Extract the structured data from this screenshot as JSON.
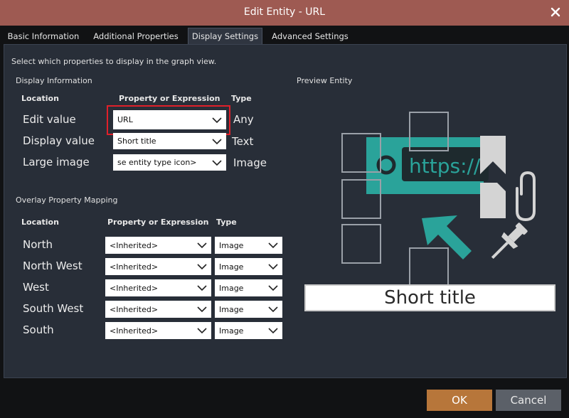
{
  "window": {
    "title": "Edit Entity - URL",
    "close_label": "✕"
  },
  "tabs": [
    {
      "label": "Basic Information"
    },
    {
      "label": "Additional Properties"
    },
    {
      "label": "Display Settings"
    },
    {
      "label": "Advanced Settings"
    }
  ],
  "active_tab": "Display Settings",
  "instructions": "Select which properties to display in the graph view.",
  "display_info": {
    "section_label": "Display Information",
    "headers": {
      "location": "Location",
      "property": "Property or Expression",
      "type": "Type"
    },
    "rows": [
      {
        "location": "Edit value",
        "property": "URL",
        "type": "Any"
      },
      {
        "location": "Display value",
        "property": "Short title",
        "type": "Text"
      },
      {
        "location": "Large image",
        "property": "se entity type icon>",
        "type": "Image"
      }
    ]
  },
  "overlay": {
    "section_label": "Overlay Property Mapping",
    "headers": {
      "location": "Location",
      "property": "Property or Expression",
      "type": "Type"
    },
    "rows": [
      {
        "location": "North",
        "property": "<Inherited>",
        "type": "Image"
      },
      {
        "location": "North West",
        "property": "<Inherited>",
        "type": "Image"
      },
      {
        "location": "West",
        "property": "<Inherited>",
        "type": "Image"
      },
      {
        "location": "South West",
        "property": "<Inherited>",
        "type": "Image"
      },
      {
        "location": "South",
        "property": "<Inherited>",
        "type": "Image"
      }
    ]
  },
  "preview": {
    "section_label": "Preview Entity",
    "url_text": "https://",
    "display_text": "Short title",
    "icon_names": [
      "url-icon",
      "bookmark-icon",
      "document-icon",
      "paperclip-icon",
      "cursor-arrow-icon",
      "pushpin-icon"
    ]
  },
  "buttons": {
    "ok": "OK",
    "cancel": "Cancel"
  },
  "colors": {
    "titlebar": "#9e5a52",
    "panel": "#282e38",
    "teal": "#2aa39a",
    "ok": "#b7763a",
    "cancel": "#5b6068",
    "highlight": "#e0202a"
  }
}
